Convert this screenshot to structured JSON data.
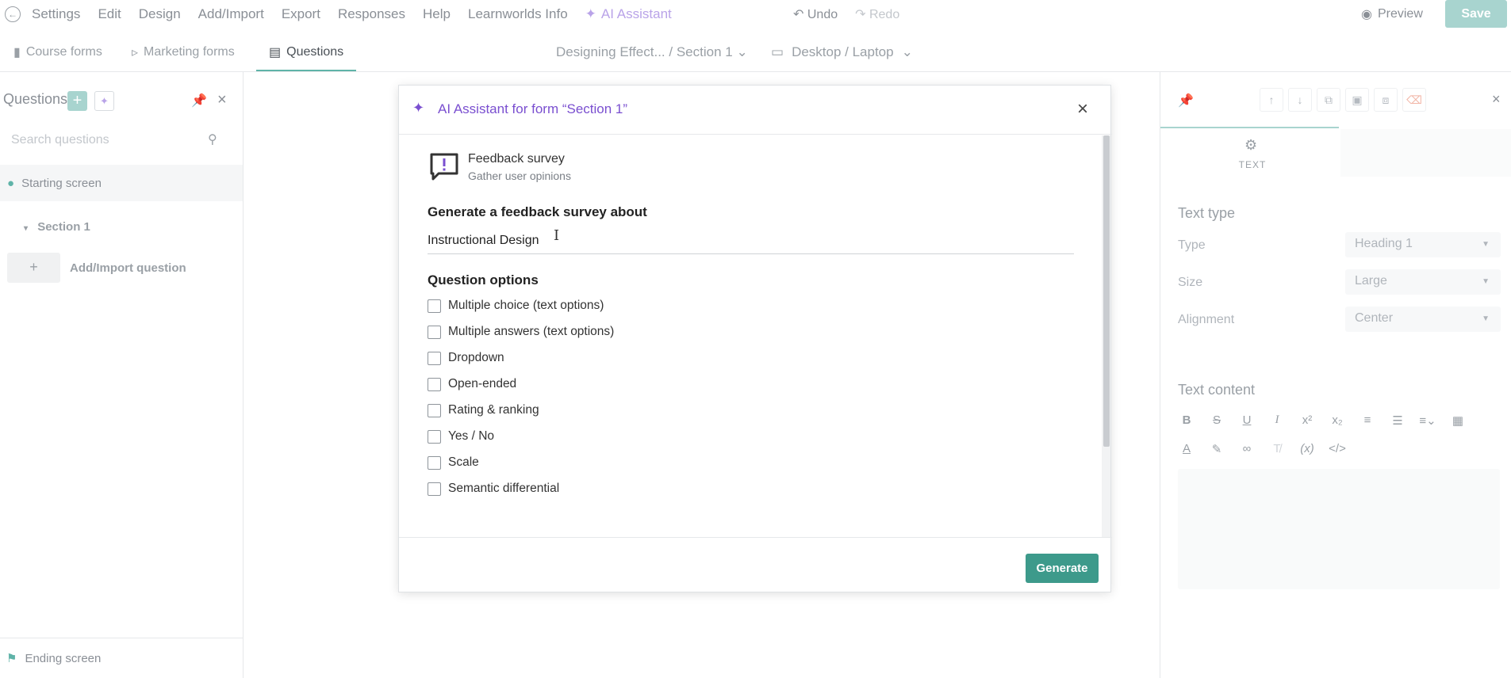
{
  "menu": {
    "items": [
      "Settings",
      "Edit",
      "Design",
      "Add/Import",
      "Export",
      "Responses",
      "Help",
      "Learnworlds Info"
    ],
    "ai_label": "AI Assistant",
    "undo": "Undo",
    "redo": "Redo",
    "preview": "Preview",
    "save": "Save"
  },
  "tabs": {
    "course_forms": "Course forms",
    "marketing_forms": "Marketing forms",
    "questions": "Questions",
    "breadcrumb": "Designing Effect... / Section 1",
    "device": "Desktop / Laptop"
  },
  "sidebar": {
    "title": "Questions",
    "search_placeholder": "Search questions",
    "starting_screen": "Starting screen",
    "section": "Section 1",
    "add_import": "Add/Import question",
    "ending_screen": "Ending screen"
  },
  "inspector": {
    "tab_label": "TEXT",
    "text_type_heading": "Text type",
    "type_label": "Type",
    "type_value": "Heading 1",
    "size_label": "Size",
    "size_value": "Large",
    "alignment_label": "Alignment",
    "alignment_value": "Center",
    "text_content_heading": "Text content"
  },
  "modal": {
    "title": "AI Assistant for form “Section 1”",
    "template_name": "Feedback survey",
    "template_desc": "Gather user opinions",
    "generate_label": "Generate a feedback survey about",
    "topic_value": "Instructional Design",
    "question_options_label": "Question options",
    "options": [
      "Multiple choice (text options)",
      "Multiple answers (text options)",
      "Dropdown",
      "Open-ended",
      "Rating & ranking",
      "Yes / No",
      "Scale",
      "Semantic differential"
    ],
    "generate_button": "Generate"
  },
  "colors": {
    "accent": "#3d9a8b",
    "accent_light": "#a8d4cf",
    "ai_purple": "#7a4fd0"
  }
}
